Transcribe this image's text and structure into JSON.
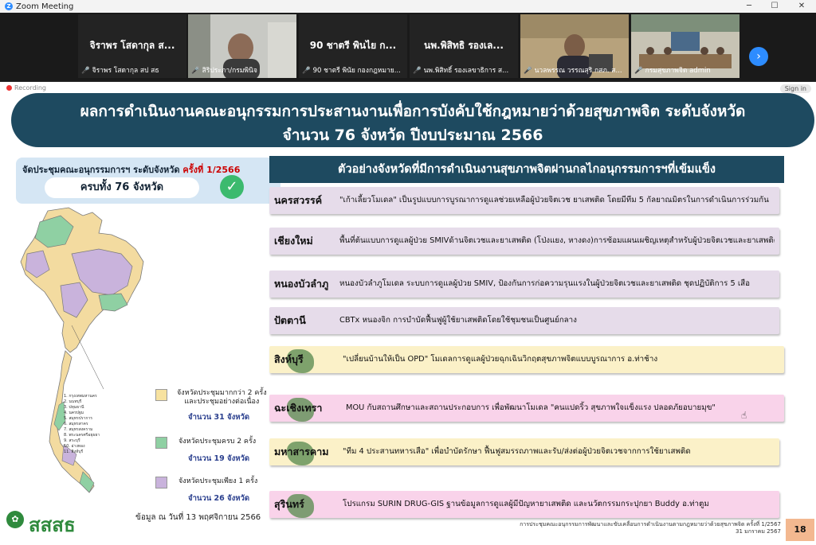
{
  "app": {
    "title": "Zoom Meeting"
  },
  "participants": [
    {
      "big": "จิราพร โสดากุล ส...",
      "small": "จิราพร โสดากุล สป สธ",
      "video": false
    },
    {
      "big": "",
      "small": "สิริประภา/กรมพินิจ",
      "video": true
    },
    {
      "big": "90 ชาตรี พินไย ก...",
      "small": "90 ชาตรี พินัย กองกฎหมาย...",
      "video": false
    },
    {
      "big": "นพ.พิสิทธิ รองเล...",
      "small": "นพ.พิสิทธิ์ รองเลขาธิการ ส...",
      "video": false
    },
    {
      "big": "",
      "small": "นวลพรรณ วรรณสุริ กสภ. ส...",
      "video": true
    },
    {
      "big": "",
      "small": "กรมสุขภาพจิต admin",
      "video": true
    }
  ],
  "slide": {
    "recording": "Recording",
    "sign_in": "Sign in",
    "title_line1": "ผลการดำเนินงานคณะอนุกรรมการประสานงานเพื่อการบังคับใช้กฎหมายว่าด้วยสุขภาพจิต ระดับจังหวัด",
    "title_line2": "จำนวน 76 จังหวัด ปีงบประมาณ 2566",
    "meeting_label": "จัดประชุมคณะอนุกรรมการฯ ระดับจังหวัด",
    "meeting_round": "ครั้งที่ 1/2566",
    "meeting_total": "ครบทั้ง 76 จังหวัด",
    "map_list": "1. กรุงเทพมหานคร\n2. นนทบุรี\n3. ปทุมธานี\n4. นครปฐม\n5. สมุทรปราการ\n6. สมุทรสาคร\n7. สมุทรสงคราม\n8. พระนครศรีอยุธยา\n9. สระบุรี\n10. อ่างทอง\n11. สิงห์บุรี",
    "legend": [
      {
        "label": "จังหวัดประชุมมากกว่า 2 ครั้ง\nและประชุมอย่างต่อเนื่อง",
        "count": "จำนวน 31 จังหวัด",
        "color": "#f7e2a0"
      },
      {
        "label": "จังหวัดประชุมครบ 2 ครั้ง",
        "count": "จำนวน 19 จังหวัด",
        "color": "#8fd0a3"
      },
      {
        "label": "จังหวัดประชุมเพียง 1 ครั้ง",
        "count": "จำนวน 26 จังหวัด",
        "color": "#c9b3dc"
      }
    ],
    "data_as_of": "ข้อมูล ณ วันที่ 13 พฤศจิกายน 2566",
    "logo_text": "สสสธ",
    "right_heading": "ตัวอย่างจังหวัดที่มีการดำเนินงานสุขภาพจิตผ่านกลไกอนุกรรมการฯที่เข้มแข็ง",
    "rows": [
      {
        "province": "นครสวรรค์",
        "desc": "\"เก้าเลี้ยวโมเดล\" เป็นรูปแบบการบูรณาการดูแลช่วยเหลือผู้ป่วยจิตเวช ยาเสพติด โดยมีทีม 5 กัลยาณมิตรในการดำเนินการร่วมกัน",
        "bg": "#e6dcea"
      },
      {
        "province": "เชียงใหม่",
        "desc": "พื้นที่ต้นแบบการดูแลผู้ป่วย SMIVด้านจิตเวชและยาเสพติด (โป่งแยง, หางดง)การซ้อมแผนเผชิญเหตุสำหรับผู้ป่วยจิตเวชและยาเสพติด",
        "bg": "#e6dcea"
      },
      {
        "province": "หนองบัวลำภู",
        "desc": "หนองบัวลำภูโมเดล ระบบการดูแลผู้ป่วย SMIV, ป้องกันการก่อความรุนแรงในผู้ป่วยจิตเวชและยาเสพติด ชุดปฏิบัติการ 5 เสือ",
        "bg": "#e6dcea"
      },
      {
        "province": "ปัตตานี",
        "desc": "CBTx หนองจิก การบำบัดฟื้นฟูผู้ใช้ยาเสพติดโดยใช้ชุมชนเป็นศูนย์กลาง",
        "bg": "#e6dcea"
      },
      {
        "province": "สิงห์บุรี",
        "desc": "\"เปลี่ยนบ้านให้เป็น OPD\" โมเดลการดูแลผู้ป่วยฉุกเฉินวิกฤตสุขภาพจิตแบบบูรณาการ อ.ท่าช้าง",
        "bg": "#fbf1c8"
      },
      {
        "province": "ฉะเชิงเทรา",
        "desc": "MOU กับสถานศึกษาและสถานประกอบการ เพื่อพัฒนาโมเดล \"คนแปดริ้ว สุขภาพใจแข็งแรง ปลอดภัยอบายมุข\"",
        "bg": "#f9d3ea"
      },
      {
        "province": "มหาสารคาม",
        "desc": "\"ทีม 4 ประสานทหารเสือ\" เพื่อบำบัดรักษา ฟื้นฟูสมรรถภาพและรับ/ส่งต่อผู้ป่วยจิตเวชจากการใช้ยาเสพติด",
        "bg": "#fbf1c8"
      },
      {
        "province": "สุรินทร์",
        "desc": "โปรแกรม SURIN DRUG-GIS ฐานข้อมูลการดูแลผู้มีปัญหายาเสพติด และนวัตกรรมกระปุกยา Buddy อ.ท่าตูม",
        "bg": "#f9d3ea"
      }
    ],
    "footer_line1": "การประชุมคณะอนุกรรมการพัฒนาและขับเคลื่อนการดำเนินงานตามกฎหมายว่าด้วยสุขภาพจิต ครั้งที่ 1/2567",
    "footer_line2": "31 มกราคม 2567",
    "page_number": "18"
  }
}
